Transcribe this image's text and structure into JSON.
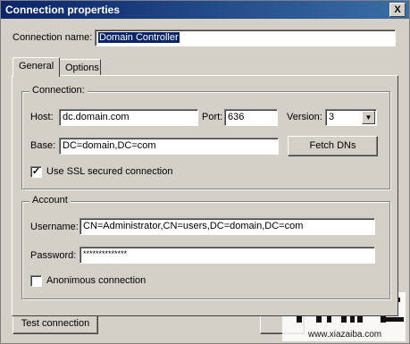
{
  "window": {
    "title": "Connection properties",
    "close_label": "X"
  },
  "connection_name": {
    "label": "Connection name:",
    "value": "Domain Controller"
  },
  "tabs": [
    {
      "label": "General"
    },
    {
      "label": "Options"
    }
  ],
  "connection": {
    "group_title": "Connection:",
    "host_label": "Host:",
    "host_value": "dc.domain.com",
    "port_label": "Port:",
    "port_value": "636",
    "version_label": "Version:",
    "version_value": "3",
    "base_label": "Base:",
    "base_value": "DC=domain,DC=com",
    "fetch_dns_label": "Fetch DNs",
    "ssl_label": "Use SSL secured connection",
    "ssl_checked": true
  },
  "account": {
    "group_title": "Account",
    "username_label": "Username:",
    "username_value": "CN=Administrator,CN=users,DC=domain,DC=com",
    "password_label": "Password:",
    "password_value": "**************",
    "anonymous_label": "Anonimous connection",
    "anonymous_checked": false
  },
  "footer": {
    "test_connection_label": "Test connection"
  },
  "watermark": {
    "site": "www.xiazaiba.com",
    "brand": "下载吧"
  },
  "colors": {
    "titlebar": "#0a246a",
    "face": "#d4d0c8",
    "selection": "#0a246a"
  }
}
